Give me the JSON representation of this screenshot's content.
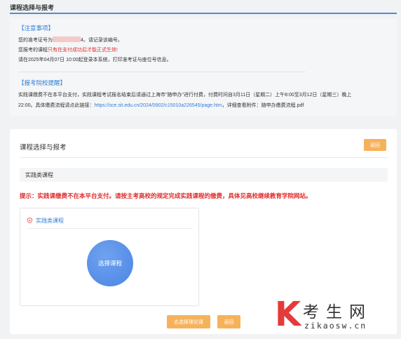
{
  "header": {
    "title": "课程选择与报考"
  },
  "notice": {
    "heading1": "【注意事项】",
    "line1_pre": "您的准考证号为",
    "line1_post": "4。请记录该编号。",
    "line2_pre": "您报考的课程",
    "line2_red": "只有在支付成功后才能正式生效!",
    "line3": "请在2025年04月07日 10:00起登录本系统，打印准考证与座位号信息。",
    "heading2": "【报考院校提醒】",
    "para1": "实践课缴费不在本平台支付，实践课程考试报名结束后请通过上海市\"随申办\"进行付费，付费时间自3月11日（星期二）上午8:00至3月12日（星期三）晚上",
    "para2_pre": "22:00。具体缴费流程请点此链接：",
    "para2_link": "https://sce.sit.edu.cn/2024/0902/c15010a226545/page.htm",
    "para2_post": "，详细查看附件：随申办缴费流程.pdf"
  },
  "main": {
    "title": "课程选择与报考",
    "return_top": "返回",
    "section_label": "实践类课程",
    "tip": "提示：实践课缴费不在本平台支付。请按主考高校的规定完成实践课程的缴费，具体见高校继续教育学院网站。",
    "card_title": "实践类课程",
    "select_button": "选择课程",
    "confirm_button": "去选择理论课",
    "return_bottom": "返回"
  },
  "watermark": {
    "k": "K",
    "cn": "考生网",
    "en": "zikaosw.cn"
  },
  "colors": {
    "accent_blue": "#2f7ed8",
    "orange": "#f6b25a",
    "red": "#e02a2a"
  },
  "icons": {
    "card_icon": "shield-icon"
  }
}
